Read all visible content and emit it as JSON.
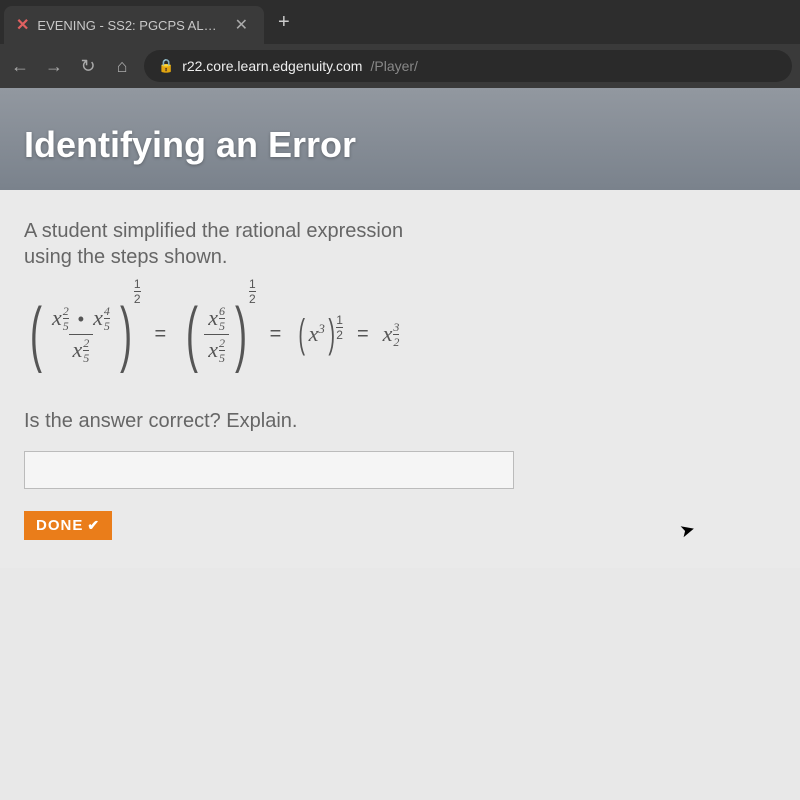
{
  "browser": {
    "tab_title": "EVENING - SS2: PGCPS ALGEBR",
    "url_domain": "r22.core.learn.edgenuity.com",
    "url_path": "/Player/"
  },
  "header": {
    "title": "Identifying an Error"
  },
  "prompt": {
    "line1": "A student simplified the rational expression",
    "line2": "using the steps shown."
  },
  "question": "Is the answer correct? Explain.",
  "done_label": "DONE",
  "math": {
    "exp_outer": {
      "n": "1",
      "d": "2"
    },
    "step1": {
      "num_a": {
        "base": "x",
        "en": "2",
        "ed": "5"
      },
      "num_b": {
        "base": "x",
        "en": "4",
        "ed": "5"
      },
      "den": {
        "base": "x",
        "en": "2",
        "ed": "5"
      }
    },
    "step2": {
      "num": {
        "base": "x",
        "en": "6",
        "ed": "5"
      },
      "den": {
        "base": "x",
        "en": "2",
        "ed": "5"
      }
    },
    "step3": {
      "base": "x",
      "exp": "3",
      "on": "1",
      "od": "2"
    },
    "step4": {
      "base": "x",
      "en": "3",
      "ed": "2"
    }
  }
}
